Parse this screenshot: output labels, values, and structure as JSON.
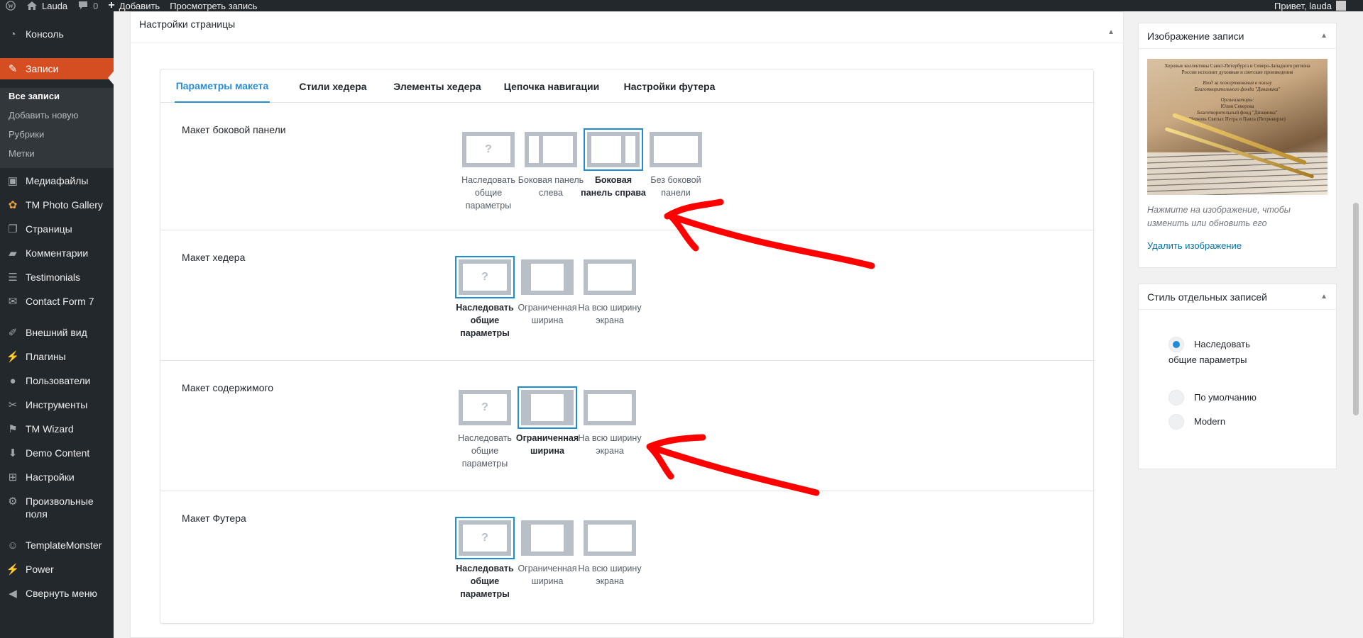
{
  "adminbar": {
    "site_name": "Lauda",
    "comments_count": "0",
    "add_new": "Добавить",
    "view_post": "Просмотреть запись",
    "greeting": "Привет, lauda"
  },
  "menu": {
    "items": [
      {
        "label": "Консоль",
        "icon": "dashboard-icon"
      },
      {
        "label": "Записи",
        "icon": "pin-icon"
      },
      {
        "label": "Медиафайлы",
        "icon": "media-icon"
      },
      {
        "label": "TM Photo Gallery",
        "icon": "gallery-icon"
      },
      {
        "label": "Страницы",
        "icon": "pages-icon"
      },
      {
        "label": "Комментарии",
        "icon": "comments-icon"
      },
      {
        "label": "Testimonials",
        "icon": "testimonials-icon"
      },
      {
        "label": "Contact Form 7",
        "icon": "mail-icon"
      },
      {
        "label": "Внешний вид",
        "icon": "brush-icon"
      },
      {
        "label": "Плагины",
        "icon": "plugin-icon"
      },
      {
        "label": "Пользователи",
        "icon": "users-icon"
      },
      {
        "label": "Инструменты",
        "icon": "tools-icon"
      },
      {
        "label": "TM Wizard",
        "icon": "flag-icon"
      },
      {
        "label": "Demo Content",
        "icon": "download-icon"
      },
      {
        "label": "Настройки",
        "icon": "settings-icon"
      },
      {
        "label": "Произвольные поля",
        "icon": "gear-icon"
      },
      {
        "label": "TemplateMonster",
        "icon": "templatemonster-icon"
      },
      {
        "label": "Power",
        "icon": "power-icon"
      },
      {
        "label": "Свернуть меню",
        "icon": "collapse-icon"
      }
    ],
    "submenu": [
      "Все записи",
      "Добавить новую",
      "Рубрики",
      "Метки"
    ]
  },
  "page_settings": {
    "title": "Настройки страницы",
    "tabs": [
      "Параметры макета",
      "Стили хедера",
      "Элементы хедера",
      "Цепочка навигации",
      "Настройки футера"
    ],
    "sections": [
      {
        "label": "Макет боковой панели",
        "options": [
          {
            "label": "Наследовать общие параметры",
            "icon": "inherit-icon",
            "selected": false
          },
          {
            "label": "Боковая панель слева",
            "icon": "sidebar-left-icon",
            "selected": false
          },
          {
            "label": "Боковая панель справа",
            "icon": "sidebar-right-icon",
            "selected": true
          },
          {
            "label": "Без боковой панели",
            "icon": "no-sidebar-icon",
            "selected": false
          }
        ]
      },
      {
        "label": "Макет хедера",
        "options": [
          {
            "label": "Наследовать общие параметры",
            "icon": "inherit-icon",
            "selected": true
          },
          {
            "label": "Ограниченная ширина",
            "icon": "boxed-icon",
            "selected": false
          },
          {
            "label": "На всю ширину экрана",
            "icon": "fullwidth-icon",
            "selected": false
          }
        ]
      },
      {
        "label": "Макет содержимого",
        "options": [
          {
            "label": "Наследовать общие параметры",
            "icon": "inherit-icon",
            "selected": false
          },
          {
            "label": "Ограниченная ширина",
            "icon": "boxed-icon",
            "selected": true
          },
          {
            "label": "На всю ширину экрана",
            "icon": "fullwidth-icon",
            "selected": false
          }
        ]
      },
      {
        "label": "Макет Футера",
        "options": [
          {
            "label": "Наследовать общие параметры",
            "icon": "inherit-icon",
            "selected": true
          },
          {
            "label": "Ограниченная ширина",
            "icon": "boxed-icon",
            "selected": false
          },
          {
            "label": "На всю ширину экрана",
            "icon": "fullwidth-icon",
            "selected": false
          }
        ]
      }
    ],
    "question_mark": "?"
  },
  "featured_image": {
    "title": "Изображение записи",
    "image_lines": [
      "Хоровые коллективы Санкт-Петербурга и Северо-Западного региона",
      "России исполнят духовные и светские произведения",
      "Вход за пожертвования в пользу",
      "Благотворительного фонда \"Динамика\"",
      "Организаторы:",
      "Юлия Северова",
      "Благотворительный фонд \"Динамика\"",
      "Церковь Святых Петра и Павла (Петрикирхе)"
    ],
    "hint": "Нажмите на изображение, чтобы изменить или обновить его",
    "remove": "Удалить изображение"
  },
  "post_style": {
    "title": "Стиль отдельных записей",
    "options": [
      {
        "label": "Наследовать общие параметры",
        "selected": true
      },
      {
        "label": "По умолчанию",
        "selected": false
      },
      {
        "label": "Modern",
        "selected": false
      }
    ]
  },
  "colors": {
    "adminbar_bg": "#23282d",
    "current_menu": "#d54e21",
    "accent": "#2a8dd4",
    "arrow": "#ff0000"
  }
}
